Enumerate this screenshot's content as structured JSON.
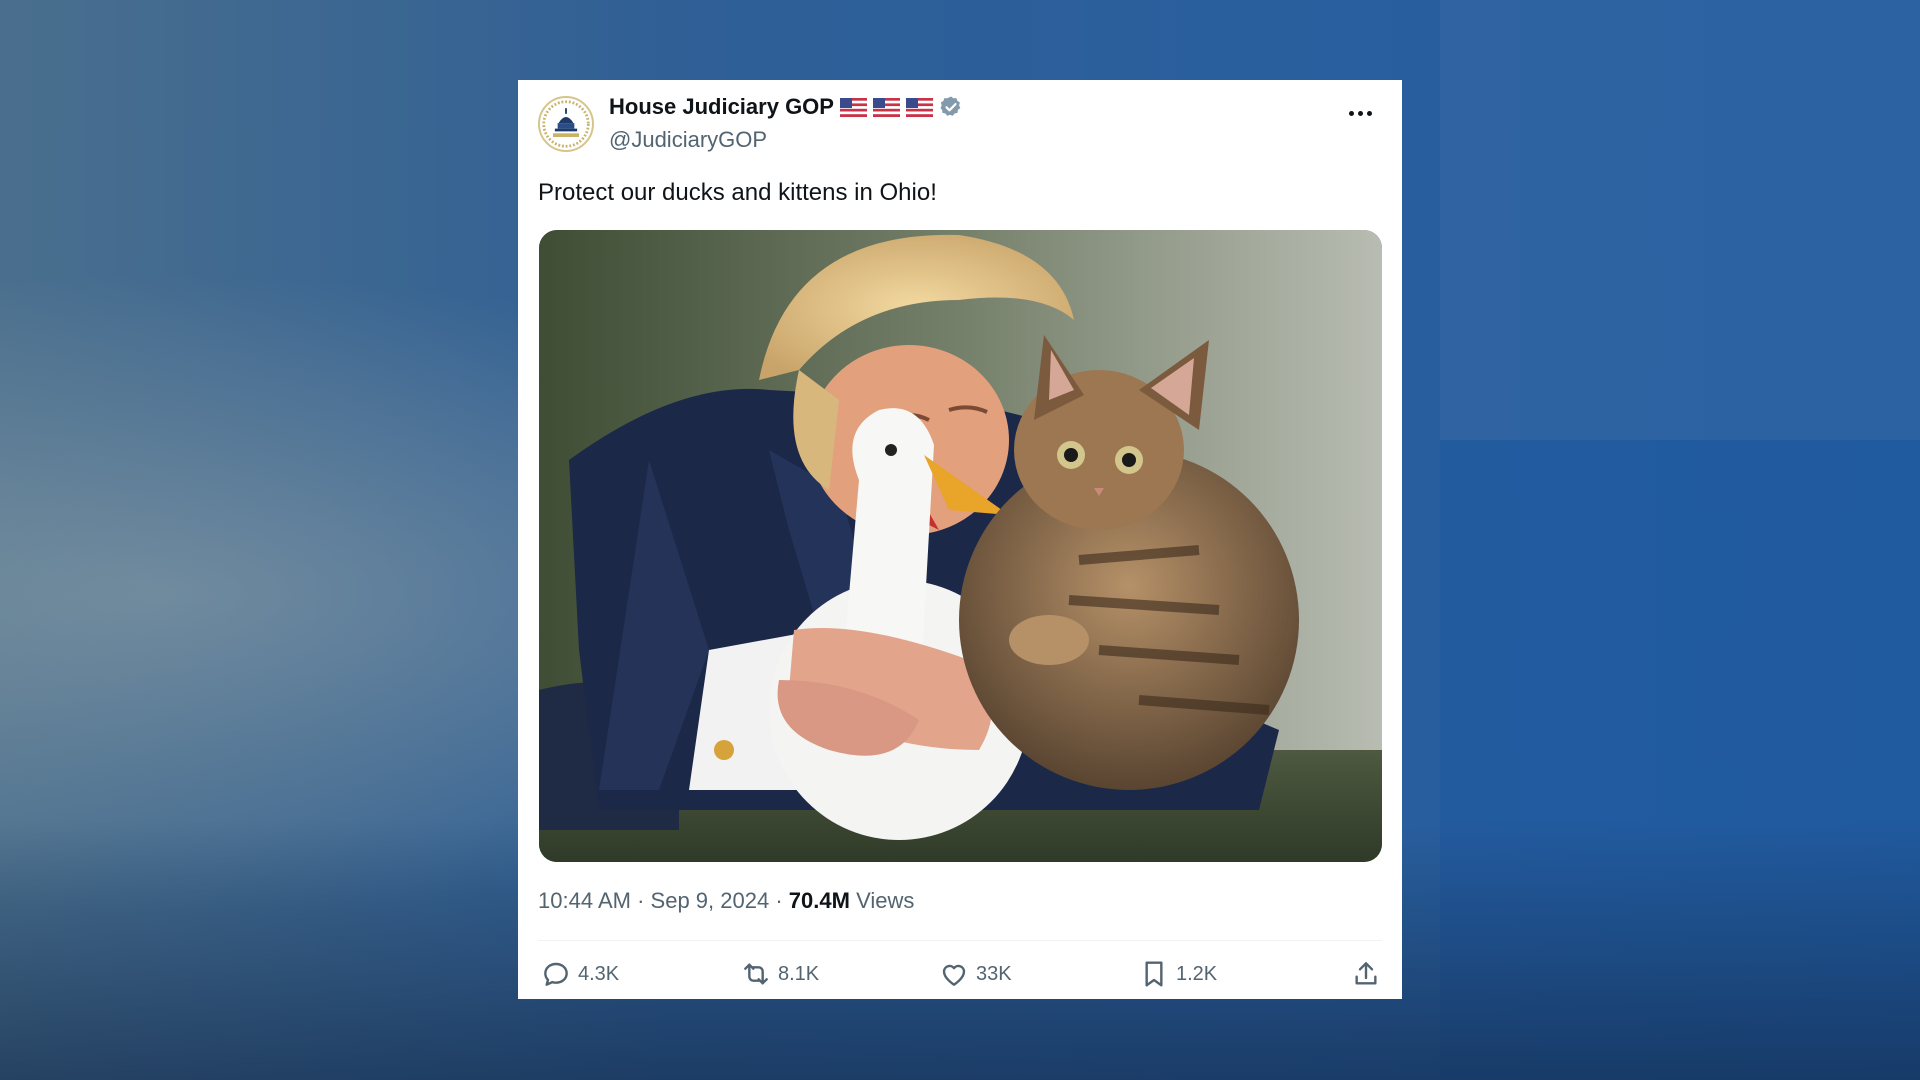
{
  "post": {
    "author_name": "House Judiciary GOP",
    "handle": "@JudiciaryGOP",
    "flag_icons": [
      "us-flag-icon",
      "us-flag-icon",
      "us-flag-icon"
    ],
    "text": "Protect our ducks and kittens in Ohio!",
    "time": "10:44 AM",
    "date": "Sep 9, 2024",
    "views_count": "70.4M",
    "views_label": "Views",
    "separator": "·"
  },
  "actions": {
    "replies": "4.3K",
    "reposts": "8.1K",
    "likes": "33K",
    "bookmarks": "1.2K"
  },
  "colors": {
    "text_primary": "#0f1419",
    "text_secondary": "#536471",
    "verified_badge": "#829aab"
  }
}
